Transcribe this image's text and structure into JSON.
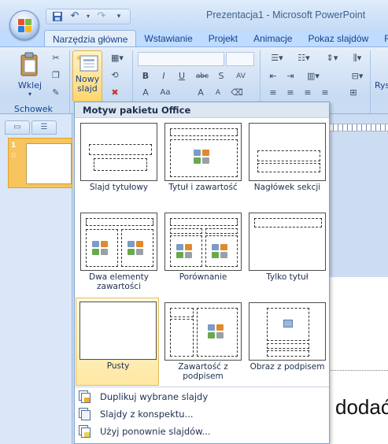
{
  "window": {
    "title": "Prezentacja1 - Microsoft PowerPoint",
    "quick_access": [
      "save-icon",
      "undo-icon",
      "redo-icon",
      "customize-icon"
    ]
  },
  "ribbon_tabs": [
    {
      "label": "Narzędzia główne",
      "active": true
    },
    {
      "label": "Wstawianie",
      "active": false
    },
    {
      "label": "Projekt",
      "active": false
    },
    {
      "label": "Animacje",
      "active": false
    },
    {
      "label": "Pokaz slajdów",
      "active": false
    },
    {
      "label": "R",
      "active": false
    }
  ],
  "ribbon": {
    "paste_label": "Wklej",
    "new_slide_label": "Nowy",
    "new_slide_label2": "slajd",
    "clipboard_group": "Schowek",
    "partial_button": "Rys",
    "font_buttons": [
      "B",
      "I",
      "U",
      "abc",
      "S",
      "AV",
      "A",
      "Aa",
      "A",
      "A"
    ]
  },
  "slides_pane": {
    "slide_number": "1",
    "transition_marker": "☆"
  },
  "slide_text": "dodać",
  "gallery": {
    "header": "Motyw pakietu Office",
    "layouts": [
      {
        "name": "Slajd tytułowy",
        "selected": false
      },
      {
        "name": "Tytuł i zawartość",
        "selected": false
      },
      {
        "name": "Nagłówek sekcji",
        "selected": false
      },
      {
        "name": "Dwa elementy zawartości",
        "selected": false
      },
      {
        "name": "Porównanie",
        "selected": false
      },
      {
        "name": "Tylko tytuł",
        "selected": false
      },
      {
        "name": "Pusty",
        "selected": true
      },
      {
        "name": "Zawartość z podpisem",
        "selected": false
      },
      {
        "name": "Obraz z podpisem",
        "selected": false
      }
    ],
    "menu": [
      {
        "label": "Duplikuj wybrane slajdy"
      },
      {
        "label": "Slajdy z konspektu..."
      },
      {
        "label": "Użyj ponownie slajdów..."
      }
    ]
  },
  "colors": {
    "selected_fill": "#ffe7a2",
    "ribbon_blue": "#15428b",
    "thumb_accent": "#f7c45d"
  }
}
